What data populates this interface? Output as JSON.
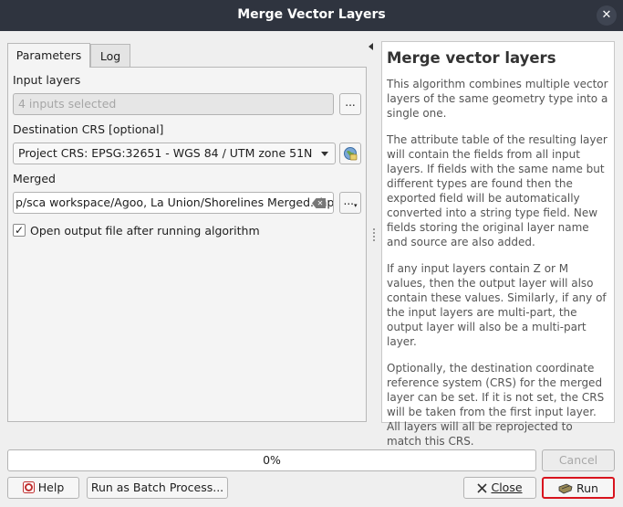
{
  "window": {
    "title": "Merge Vector Layers",
    "close_icon": "close-icon"
  },
  "tabs": [
    {
      "label": "Parameters",
      "active": true
    },
    {
      "label": "Log",
      "active": false
    }
  ],
  "params": {
    "input_layers": {
      "label": "Input layers",
      "placeholder": "4 inputs selected",
      "browse_label": "..."
    },
    "dest_crs": {
      "label": "Destination CRS [optional]",
      "value": "Project CRS: EPSG:32651 - WGS 84 / UTM zone 51N"
    },
    "merged": {
      "label": "Merged",
      "value": "p/sca workspace/Agoo, La Union/Shorelines Merged.shp",
      "browse_label": "..."
    },
    "open_output": {
      "label": "Open output file after running algorithm",
      "checked": true
    }
  },
  "help": {
    "title": "Merge vector layers",
    "paragraphs": [
      "This algorithm combines multiple vector layers of the same geometry type into a single one.",
      "The attribute table of the resulting layer will contain the fields from all input layers. If fields with the same name but different types are found then the exported field will be automatically converted into a string type field. New fields storing the original layer name and source are also added.",
      "If any input layers contain Z or M values, then the output layer will also contain these values. Similarly, if any of the input layers are multi-part, the output layer will also be a multi-part layer.",
      "Optionally, the destination coordinate reference system (CRS) for the merged layer can be set. If it is not set, the CRS will be taken from the first input layer. All layers will all be reprojected to match this CRS."
    ]
  },
  "progress": {
    "label": "0%",
    "value": 0
  },
  "buttons": {
    "cancel": "Cancel",
    "help": "Help",
    "batch": "Run as Batch Process...",
    "close": "Close",
    "run": "Run"
  },
  "colors": {
    "titlebar": "#2f343f",
    "run_highlight": "#d8141e"
  }
}
